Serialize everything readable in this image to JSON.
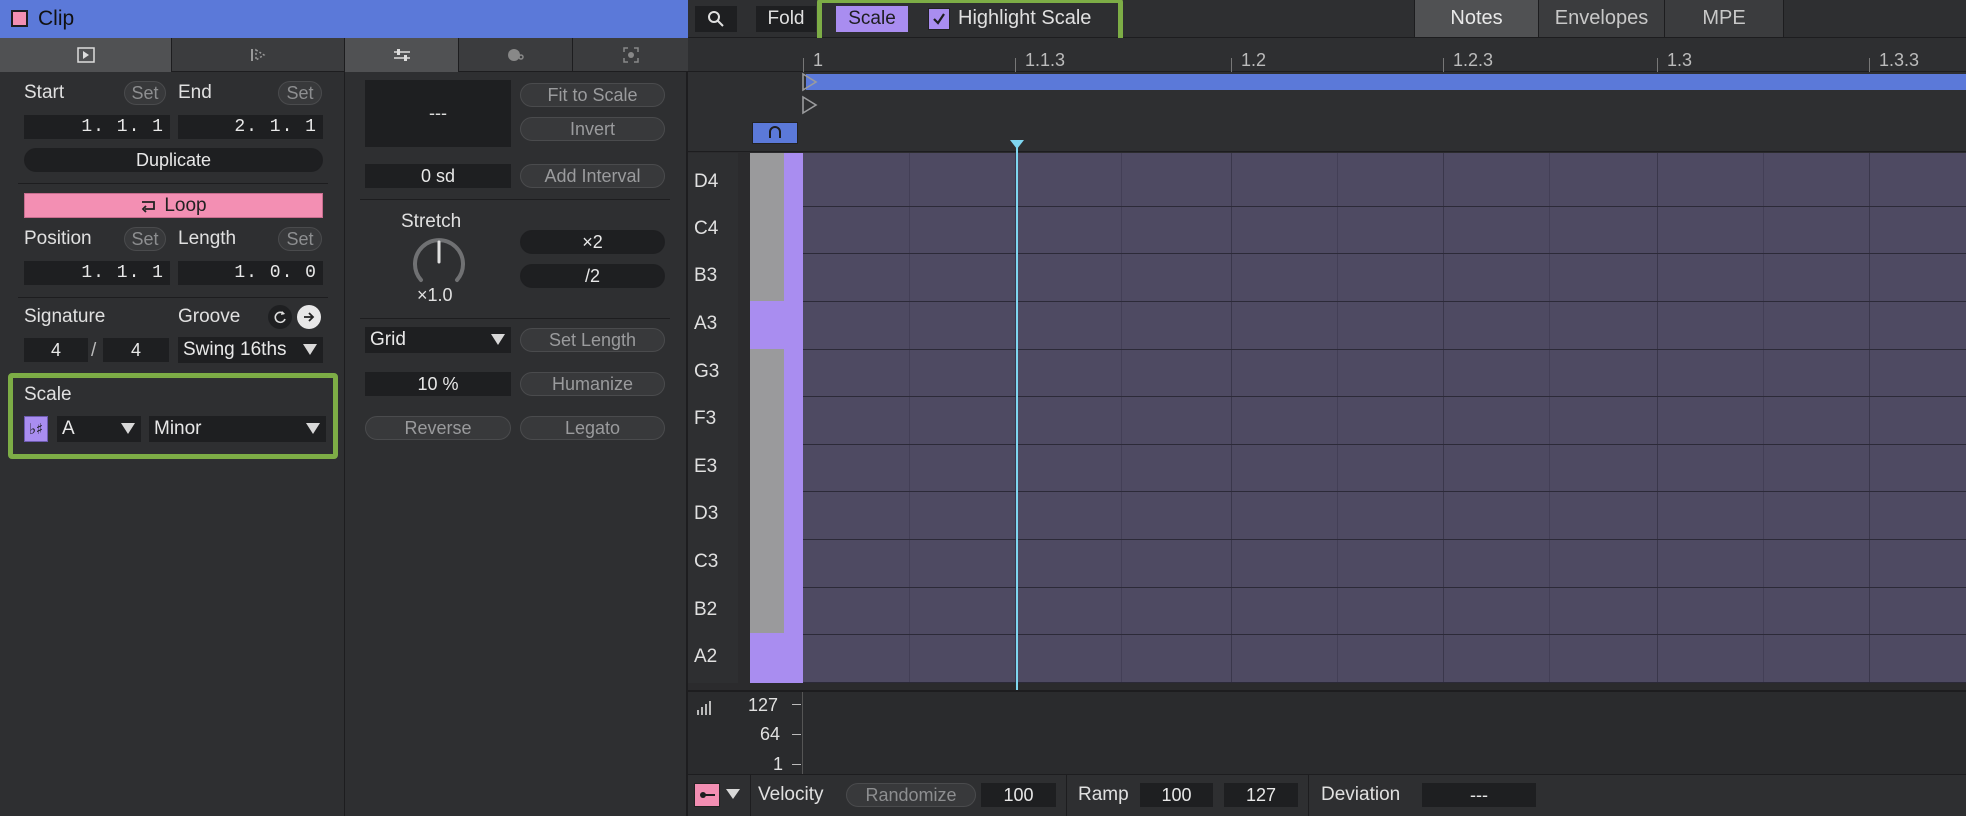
{
  "clip": {
    "title": "Clip",
    "start_label": "Start",
    "end_label": "End",
    "set_label": "Set",
    "start_value": "1. 1. 1",
    "end_value": "2. 1. 1",
    "duplicate_label": "Duplicate",
    "loop_label": "Loop",
    "position_label": "Position",
    "length_label": "Length",
    "position_value": "1. 1. 1",
    "length_value": "1. 0. 0",
    "signature_label": "Signature",
    "groove_label": "Groove",
    "sig_num": "4",
    "sig_slash": "/",
    "sig_den": "4",
    "groove_value": "Swing 16ths",
    "scale_label": "Scale",
    "scale_icon_text": "♭♯",
    "scale_root": "A",
    "scale_mode": "Minor"
  },
  "tools": {
    "display_value": "---",
    "fit_to_scale": "Fit to Scale",
    "invert": "Invert",
    "sd_value": "0 sd",
    "add_interval": "Add Interval",
    "stretch_label": "Stretch",
    "stretch_value": "×1.0",
    "times2": "×2",
    "div2": "/2",
    "grid_value": "Grid",
    "set_length": "Set Length",
    "percent_value": "10 %",
    "humanize": "Humanize",
    "reverse": "Reverse",
    "legato": "Legato"
  },
  "editor_top": {
    "fold": "Fold",
    "scale": "Scale",
    "highlight_scale": "Highlight Scale",
    "notes": "Notes",
    "envelopes": "Envelopes",
    "mpe": "MPE"
  },
  "ruler": [
    "1",
    "1.1.3",
    "1.2",
    "1.2.3",
    "1.3",
    "1.3.3"
  ],
  "keys": [
    "D4",
    "C4",
    "B3",
    "A3",
    "G3",
    "F3",
    "E3",
    "D3",
    "C3",
    "B2",
    "A2"
  ],
  "velocity_scale": [
    "127",
    "64",
    "1"
  ],
  "bottom": {
    "velocity_label": "Velocity",
    "randomize": "Randomize",
    "velocity_value": "100",
    "ramp_label": "Ramp",
    "ramp_start": "100",
    "ramp_end": "127",
    "deviation_label": "Deviation",
    "deviation_value": "---"
  },
  "colors": {
    "accent_blue": "#5b79d9",
    "loop_pink": "#f38fb3",
    "scale_purple": "#a98df0",
    "grid_purple": "#4e4a62",
    "highlight_green": "#8bc34a",
    "playhead": "#7fd6f0"
  }
}
